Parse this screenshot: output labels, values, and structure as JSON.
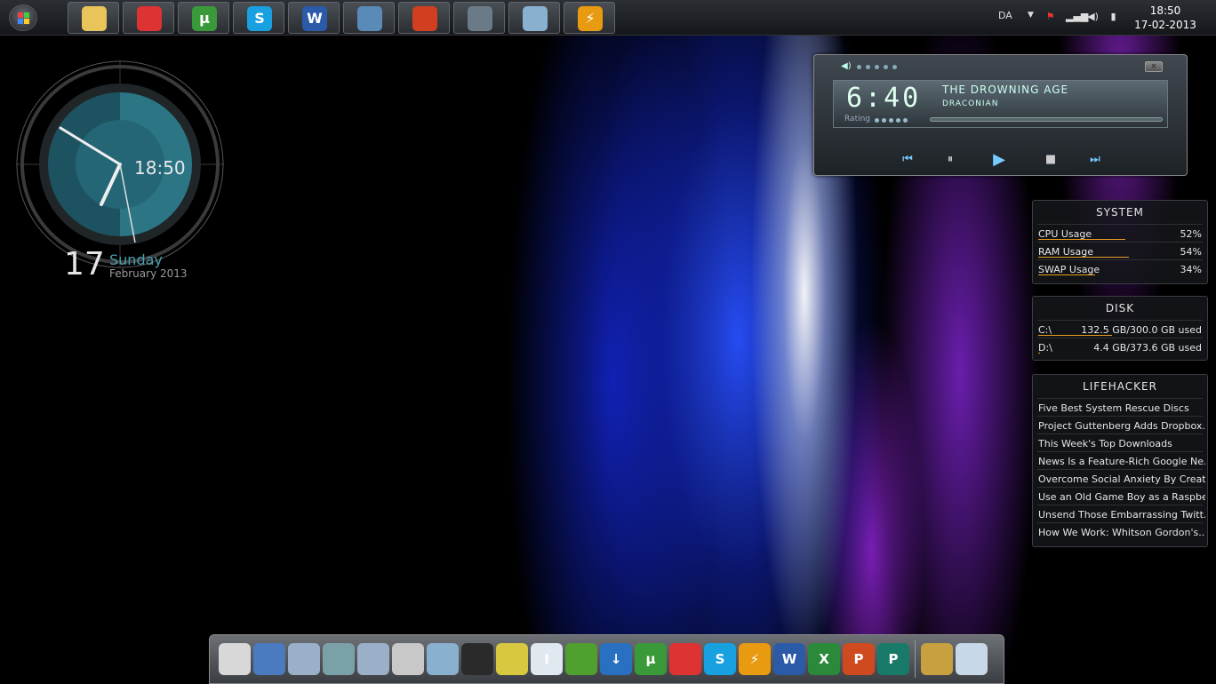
{
  "taskbar": {
    "language": "DA",
    "time": "18:50",
    "date": "17-02-2013",
    "pinned": [
      {
        "name": "explorer-icon",
        "glyph": "",
        "color": "#e8c45a"
      },
      {
        "name": "chrome-icon",
        "glyph": "",
        "color": "#d33"
      },
      {
        "name": "utorrent-icon",
        "glyph": "µ",
        "color": "#3a9a3a"
      },
      {
        "name": "skype-icon",
        "glyph": "S",
        "color": "#18a0e0"
      },
      {
        "name": "word-icon",
        "glyph": "W",
        "color": "#2a5aa8"
      },
      {
        "name": "control-panel-icon",
        "glyph": "",
        "color": "#5a8ab8"
      },
      {
        "name": "volume-tool-icon",
        "glyph": "",
        "color": "#d04020"
      },
      {
        "name": "starcraft-icon",
        "glyph": "",
        "color": "#6a7a88"
      },
      {
        "name": "calculator-icon",
        "glyph": "",
        "color": "#8ab0d0"
      },
      {
        "name": "winamp-icon",
        "glyph": "⚡",
        "color": "#e89a10"
      }
    ]
  },
  "clock_gadget": {
    "digital_time": "18:50",
    "day": "17",
    "weekday": "Sunday",
    "month_year": "February 2013"
  },
  "player": {
    "time": "6:40",
    "track_title": "THE DROWNING AGE",
    "artist": "DRACONIAN",
    "rating_label": "Rating"
  },
  "system_panel": {
    "title": "SYSTEM",
    "rows": [
      {
        "label": "CPU Usage",
        "value": "52%",
        "level": 0.52
      },
      {
        "label": "RAM Usage",
        "value": "54%",
        "level": 0.54
      },
      {
        "label": "SWAP Usage",
        "value": "34%",
        "level": 0.34
      }
    ]
  },
  "disk_panel": {
    "title": "DISK",
    "rows": [
      {
        "label": "C:\\",
        "value": "132.5 GB/300.0 GB used",
        "level": 0.44
      },
      {
        "label": "D:\\",
        "value": "4.4 GB/373.6 GB used",
        "level": 0.01
      }
    ]
  },
  "lifehacker_panel": {
    "title": "LIFEHACKER",
    "items": [
      "Five Best System Rescue Discs",
      "Project Guttenberg Adds Dropbox...",
      "This Week's Top Downloads",
      "News Is a Feature-Rich Google Ne...",
      "Overcome Social Anxiety By Creati...",
      "Use an Old Game Boy as a Raspber...",
      "Unsend Those Embarrassing Twitt...",
      "How We Work: Whitson Gordon's..."
    ]
  },
  "dock": {
    "icons": [
      {
        "name": "preview-icon",
        "glyph": "",
        "color": "#d8d8d8"
      },
      {
        "name": "globe-icon",
        "glyph": "",
        "color": "#4a7ac0"
      },
      {
        "name": "folder-icon",
        "glyph": "",
        "color": "#9ab0c8"
      },
      {
        "name": "folder-green-icon",
        "glyph": "",
        "color": "#7aa0a8"
      },
      {
        "name": "folder-images-icon",
        "glyph": "",
        "color": "#9ab0c8"
      },
      {
        "name": "system-tools-icon",
        "glyph": "",
        "color": "#c8c8c8"
      },
      {
        "name": "calculator-icon",
        "glyph": "",
        "color": "#8ab0d0"
      },
      {
        "name": "steam-icon",
        "glyph": "",
        "color": "#2a2a2a"
      },
      {
        "name": "win7-mac-icon",
        "glyph": "",
        "color": "#d8c840"
      },
      {
        "name": "text-editor-icon",
        "glyph": "I",
        "color": "#e0e8f0"
      },
      {
        "name": "windows-icon",
        "glyph": "",
        "color": "#50a030"
      },
      {
        "name": "download-icon",
        "glyph": "↓",
        "color": "#2a70c0"
      },
      {
        "name": "utorrent-icon",
        "glyph": "µ",
        "color": "#3a9a3a"
      },
      {
        "name": "chrome-icon",
        "glyph": "",
        "color": "#d33"
      },
      {
        "name": "skype-icon",
        "glyph": "S",
        "color": "#18a0e0"
      },
      {
        "name": "winamp-icon",
        "glyph": "⚡",
        "color": "#e89a10"
      },
      {
        "name": "word-icon",
        "glyph": "W",
        "color": "#2a5aa8"
      },
      {
        "name": "excel-icon",
        "glyph": "X",
        "color": "#2a8a3a"
      },
      {
        "name": "powerpoint-icon",
        "glyph": "P",
        "color": "#d04a20"
      },
      {
        "name": "publisher-icon",
        "glyph": "P",
        "color": "#1a7a6a"
      },
      {
        "name": "tools-icon",
        "glyph": "",
        "color": "#c8a040"
      },
      {
        "name": "recycle-bin-icon",
        "glyph": "",
        "color": "#c8d8e8"
      }
    ]
  }
}
